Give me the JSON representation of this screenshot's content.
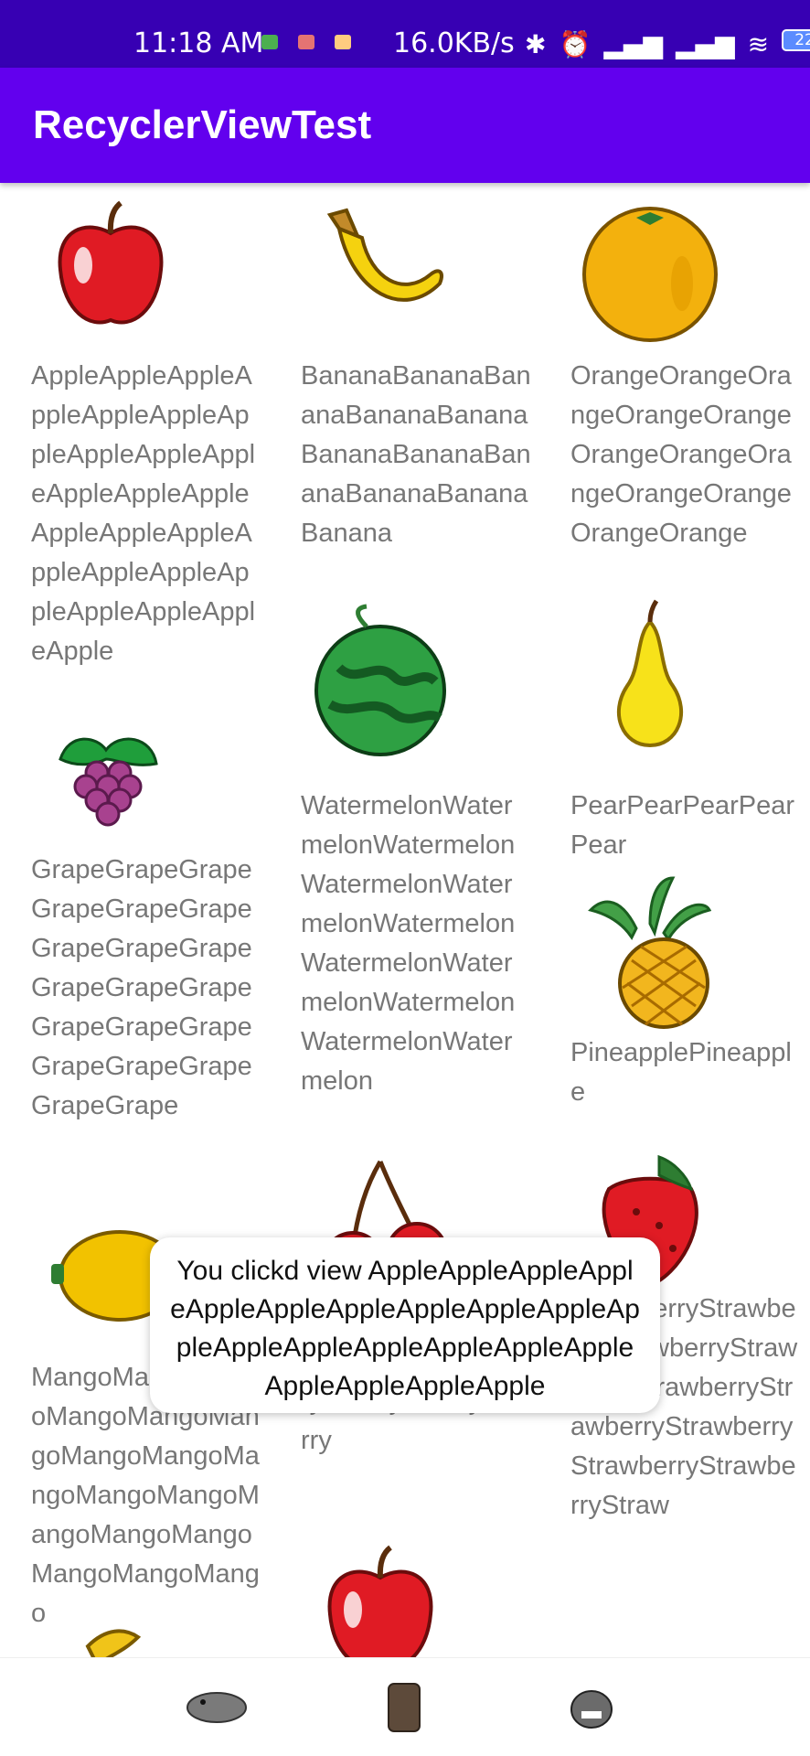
{
  "status_bar": {
    "time": "11:18 AM",
    "net_speed": "16.0KB/s",
    "battery": "22"
  },
  "app_bar": {
    "title": "RecyclerViewTest"
  },
  "fruits": [
    {
      "name": "AppleAppleAppleAppleAppleAppleAppleAppleAppleAppleAppleAppleAppleAppleAppleAppleAppleAppleAppleAppleAppleAppleAppleApple",
      "icon": "apple-icon"
    },
    {
      "name": "BananaBananaBananaBananaBananaBananaBananaBananaBananaBananaBanana",
      "icon": "banana-icon"
    },
    {
      "name": "OrangeOrangeOrangeOrangeOrangeOrangeOrangeOrangeOrangeOrangeOrangeOrange",
      "icon": "orange-icon"
    },
    {
      "name": "GrapeGrapeGrapeGrapeGrapeGrapeGrapeGrapeGrapeGrapeGrapeGrapeGrapeGrapeGrapeGrapeGrapeGrapeGrapeGrape",
      "icon": "grape-icon"
    },
    {
      "name": "WatermelonWatermelonWatermelonWatermelonWatermelonWatermelonWatermelonWatermelonWatermelonWatermelonWatermelon",
      "icon": "watermelon-icon"
    },
    {
      "name": "PearPearPearPearPear",
      "icon": "pear-icon"
    },
    {
      "name": "PineapplePineapple",
      "icon": "pineapple-icon"
    },
    {
      "name": "MangoMangoMangoMangoMangoMangoMangoMangoMangoMangoMangoMangoMangoMangoMangoMangoMango",
      "icon": "mango-icon"
    },
    {
      "name": "CherryCherryCherryCherryCherryCherryCherryCherryCherry",
      "icon": "cherry-icon"
    },
    {
      "name": "StrawberryStrawberryStrawberryStrawberryStrawberryStrawberryStrawberryStrawberryStrawberryStraw",
      "icon": "strawberry-icon"
    }
  ],
  "toast": {
    "message": "You clickd view AppleAppleAppleAppleAppleAppleAppleAppleAppleAppleAppleAppleAppleAppleAppleAppleAppleAppleAppleAppleApple"
  },
  "bottom_nav": [
    "hippo-icon",
    "tree-stump-icon",
    "monster-icon"
  ]
}
